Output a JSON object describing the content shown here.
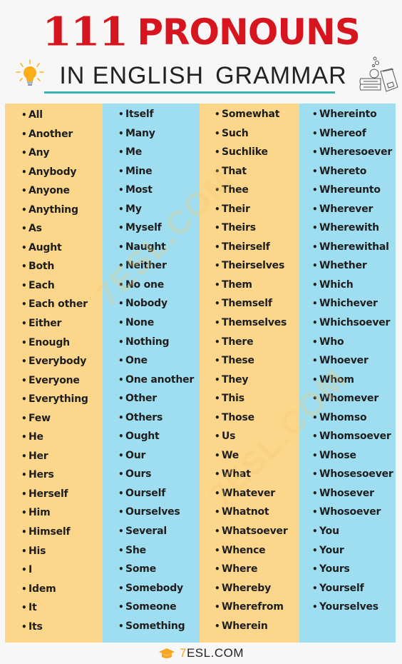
{
  "header": {
    "title_number": "111",
    "title_word": "PRONOUNS",
    "subtitle_part1": "IN ENGLISH",
    "subtitle_part2": "GRAMMAR"
  },
  "icons": {
    "left": "lightbulb-icon",
    "right": "books-icon",
    "footer": "graduation-cap-icon"
  },
  "colors": {
    "title_red": "#d7151f",
    "underline_teal": "#3bb3b0",
    "column_yellow": "#fcd68a",
    "column_blue": "#9fdef1",
    "logo_orange": "#f5a623"
  },
  "bullet": "•",
  "columns": [
    [
      "All",
      "Another",
      "Any",
      "Anybody",
      "Anyone",
      "Anything",
      "As",
      "Aught",
      "Both",
      "Each",
      "Each other",
      "Either",
      "Enough",
      "Everybody",
      "Everyone",
      "Everything",
      "Few",
      "He",
      "Her",
      "Hers",
      "Herself",
      "Him",
      "Himself",
      "His",
      "I",
      "Idem",
      "It",
      "Its"
    ],
    [
      "Itself",
      "Many",
      "Me",
      "Mine",
      "Most",
      "My",
      "Myself",
      "Naught",
      "Neither",
      "No one",
      "Nobody",
      "None",
      "Nothing",
      "One",
      "One another",
      "Other",
      "Others",
      "Ought",
      "Our",
      "Ours",
      "Ourself",
      "Ourselves",
      "Several",
      "She",
      "Some",
      "Somebody",
      "Someone",
      "Something"
    ],
    [
      "Somewhat",
      "Such",
      "Suchlike",
      "That",
      "Thee",
      "Their",
      "Theirs",
      "Theirself",
      "Theirselves",
      "Them",
      "Themself",
      "Themselves",
      "There",
      "These",
      "They",
      "This",
      "Those",
      "Us",
      "We",
      "What",
      "Whatever",
      "Whatnot",
      "Whatsoever",
      "Whence",
      "Where",
      "Whereby",
      "Wherefrom",
      "Wherein"
    ],
    [
      "Whereinto",
      "Whereof",
      "Wheresoever",
      "Whereto",
      "Whereunto",
      "Wherever",
      "Wherewith",
      "Wherewithal",
      "Whether",
      "Which",
      "Whichever",
      "Whichsoever",
      "Who",
      "Whoever",
      "Whom",
      "Whomever",
      "Whomso",
      "Whomsoever",
      "Whose",
      "Whosesoever",
      "Whosever",
      "Whosoever",
      "You",
      "Your",
      "Yours",
      "Yourself",
      "Yourselves"
    ]
  ],
  "watermark": "7ESL.COM",
  "footer": {
    "brand_seven": "7",
    "brand_rest": "ESL.COM"
  }
}
